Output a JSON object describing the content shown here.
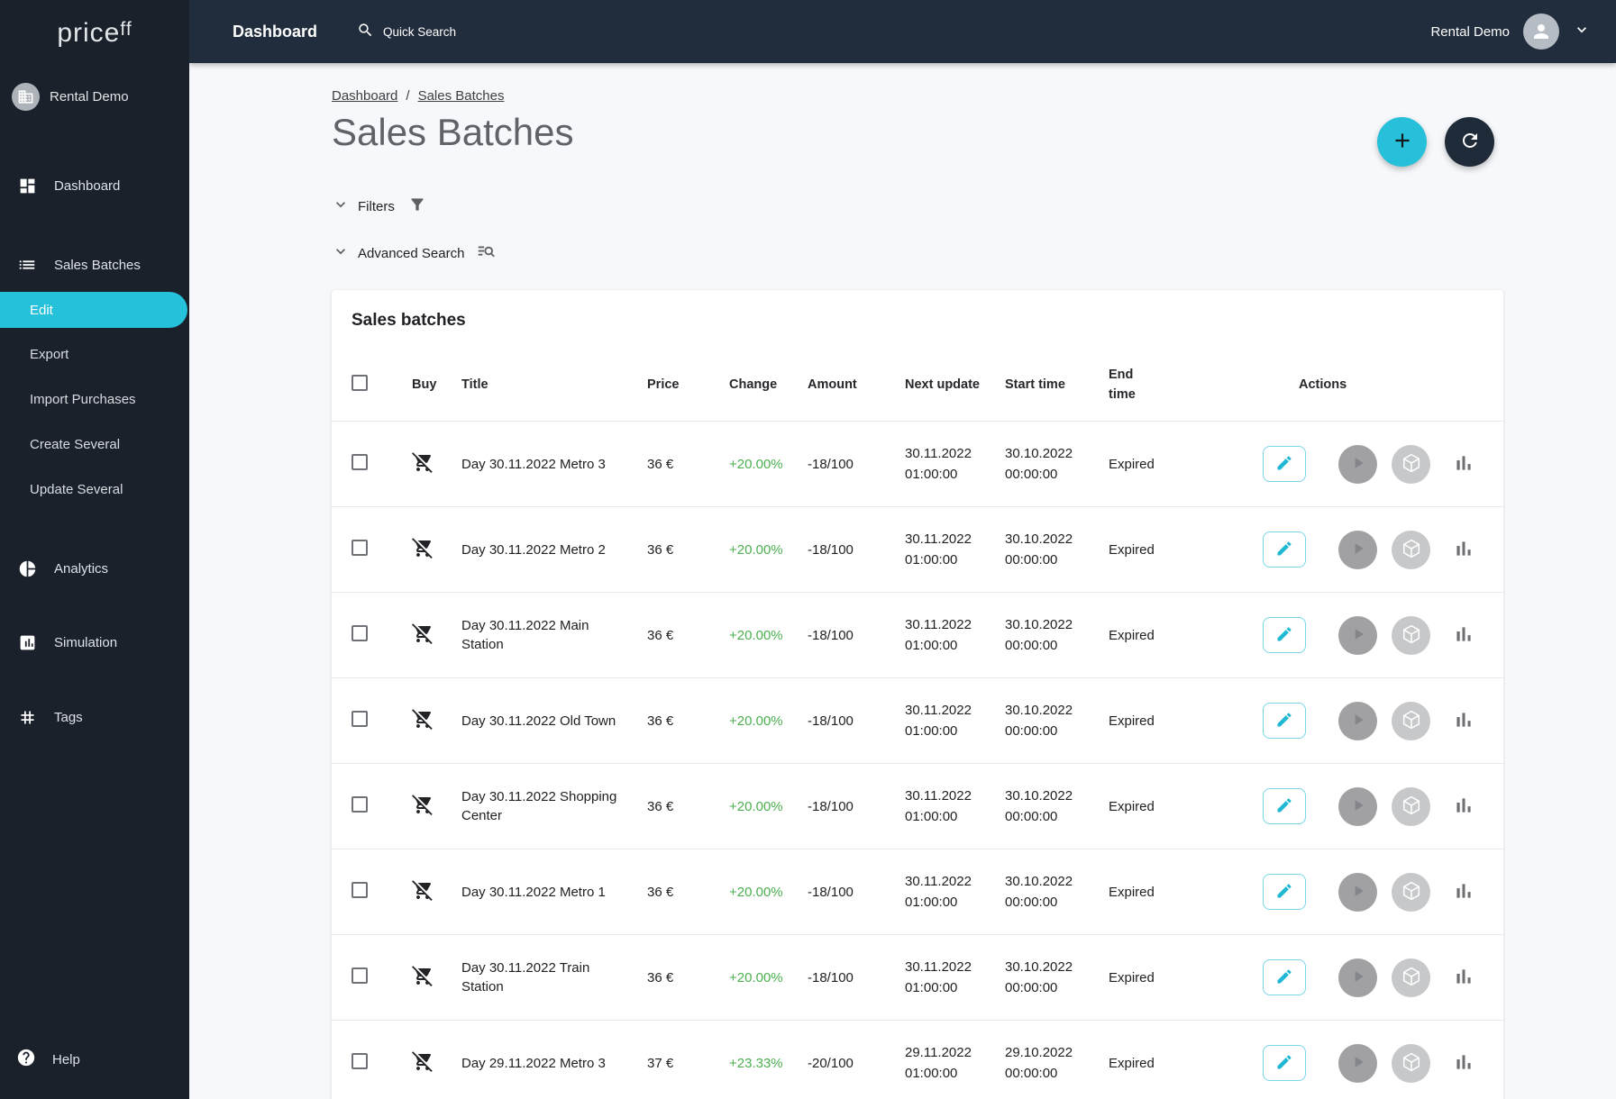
{
  "brand": {
    "logo_text": "price",
    "logo_sup": "ff"
  },
  "topbar": {
    "title": "Dashboard",
    "search_label": "Quick Search",
    "account_name": "Rental Demo"
  },
  "sidebar": {
    "account": "Rental Demo",
    "dashboard": "Dashboard",
    "sales_batches": "Sales Batches",
    "sub": {
      "edit": "Edit",
      "export": "Export",
      "import": "Import Purchases",
      "create": "Create Several",
      "update": "Update Several"
    },
    "analytics": "Analytics",
    "simulation": "Simulation",
    "tags": "Tags",
    "help": "Help"
  },
  "page": {
    "breadcrumb": {
      "dashboard": "Dashboard",
      "separator": "/",
      "current": "Sales Batches"
    },
    "title": "Sales Batches",
    "filters_label": "Filters",
    "advanced_search_label": "Advanced Search"
  },
  "table": {
    "card_title": "Sales batches",
    "columns": [
      "Buy",
      "Title",
      "Price",
      "Change",
      "Amount",
      "Next update",
      "Start time",
      "End time",
      "Actions"
    ],
    "rows": [
      {
        "title": "Day 30.11.2022 Metro 3",
        "price": "36 €",
        "change": "+20.00%",
        "amount": "-18/100",
        "next_update_date": "30.11.2022",
        "next_update_time": "01:00:00",
        "start_date": "30.10.2022",
        "start_time": "00:00:00",
        "end_time": "Expired"
      },
      {
        "title": "Day 30.11.2022 Metro 2",
        "price": "36 €",
        "change": "+20.00%",
        "amount": "-18/100",
        "next_update_date": "30.11.2022",
        "next_update_time": "01:00:00",
        "start_date": "30.10.2022",
        "start_time": "00:00:00",
        "end_time": "Expired"
      },
      {
        "title": "Day 30.11.2022 Main Station",
        "price": "36 €",
        "change": "+20.00%",
        "amount": "-18/100",
        "next_update_date": "30.11.2022",
        "next_update_time": "01:00:00",
        "start_date": "30.10.2022",
        "start_time": "00:00:00",
        "end_time": "Expired"
      },
      {
        "title": "Day 30.11.2022 Old Town",
        "price": "36 €",
        "change": "+20.00%",
        "amount": "-18/100",
        "next_update_date": "30.11.2022",
        "next_update_time": "01:00:00",
        "start_date": "30.10.2022",
        "start_time": "00:00:00",
        "end_time": "Expired"
      },
      {
        "title": "Day 30.11.2022 Shopping Center",
        "price": "36 €",
        "change": "+20.00%",
        "amount": "-18/100",
        "next_update_date": "30.11.2022",
        "next_update_time": "01:00:00",
        "start_date": "30.10.2022",
        "start_time": "00:00:00",
        "end_time": "Expired"
      },
      {
        "title": "Day 30.11.2022 Metro 1",
        "price": "36 €",
        "change": "+20.00%",
        "amount": "-18/100",
        "next_update_date": "30.11.2022",
        "next_update_time": "01:00:00",
        "start_date": "30.10.2022",
        "start_time": "00:00:00",
        "end_time": "Expired"
      },
      {
        "title": "Day 30.11.2022 Train Station",
        "price": "36 €",
        "change": "+20.00%",
        "amount": "-18/100",
        "next_update_date": "30.11.2022",
        "next_update_time": "01:00:00",
        "start_date": "30.10.2022",
        "start_time": "00:00:00",
        "end_time": "Expired"
      },
      {
        "title": "Day 29.11.2022 Metro 3",
        "price": "37 €",
        "change": "+23.33%",
        "amount": "-20/100",
        "next_update_date": "29.11.2022",
        "next_update_time": "01:00:00",
        "start_date": "29.10.2022",
        "start_time": "00:00:00",
        "end_time": "Expired"
      }
    ]
  },
  "colors": {
    "accent_cyan": "#25c0d9",
    "positive_green": "#4caf50",
    "sidebar_bg": "#1a212b",
    "topbar_bg": "#212d3c",
    "page_bg": "#f7f8fb"
  }
}
